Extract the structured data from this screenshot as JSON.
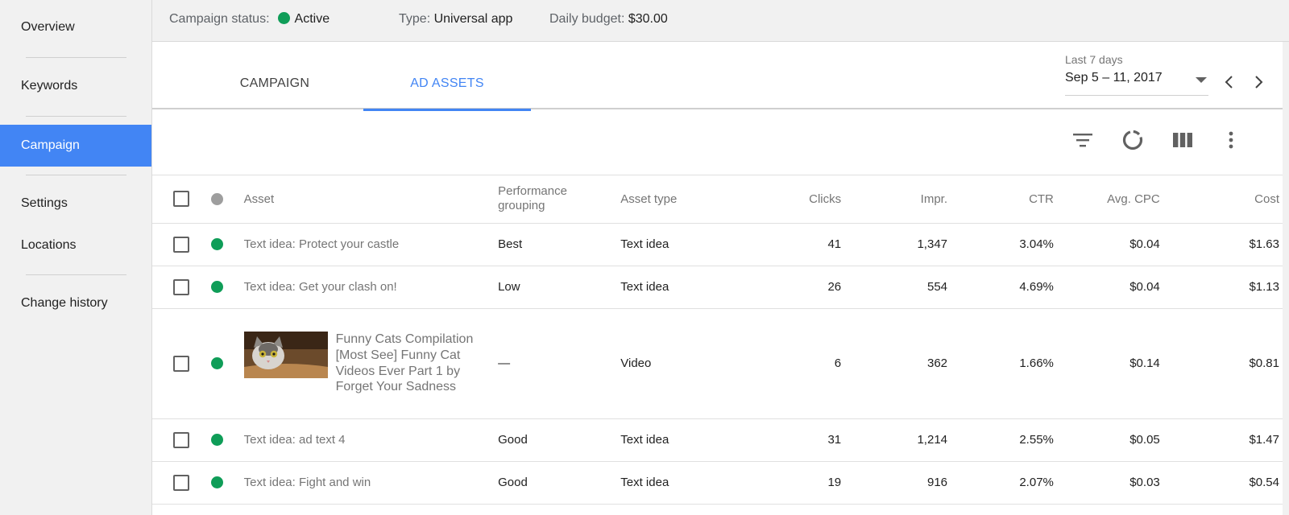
{
  "sidebar": {
    "items": [
      {
        "label": "Overview"
      },
      {
        "label": "Keywords"
      },
      {
        "label": "Campaign"
      },
      {
        "label": "Settings"
      },
      {
        "label": "Locations"
      },
      {
        "label": "Change history"
      }
    ],
    "active": "Campaign"
  },
  "status_bar": {
    "campaign_status_label": "Campaign status:",
    "campaign_status_value": "Active",
    "type_label": "Type:",
    "type_value": "Universal app",
    "budget_label": "Daily budget:",
    "budget_value": "$30.00"
  },
  "tabs": [
    {
      "label": "CAMPAIGN",
      "active": false
    },
    {
      "label": "AD ASSETS",
      "active": true
    }
  ],
  "date_range": {
    "label": "Last 7 days",
    "value": "Sep 5 – 11, 2017"
  },
  "toolbar": {
    "icons": [
      "filter-icon",
      "segment-icon",
      "columns-icon",
      "more-vert-icon"
    ]
  },
  "table": {
    "headers": {
      "asset": "Asset",
      "performance": "Performance grouping",
      "asset_type": "Asset type",
      "clicks": "Clicks",
      "impr": "Impr.",
      "ctr": "CTR",
      "avg_cpc": "Avg. CPC",
      "cost": "Cost"
    },
    "rows": [
      {
        "asset": "Text idea: Protect your castle",
        "performance": "Best",
        "asset_type": "Text idea",
        "clicks": "41",
        "impr": "1,347",
        "ctr": "3.04%",
        "avg_cpc": "$0.04",
        "cost": "$1.63"
      },
      {
        "asset": "Text idea: Get your clash on!",
        "performance": "Low",
        "asset_type": "Text idea",
        "clicks": "26",
        "impr": "554",
        "ctr": "4.69%",
        "avg_cpc": "$0.04",
        "cost": "$1.13"
      },
      {
        "asset": "Funny Cats Compilation [Most See] Funny Cat Videos Ever Part 1 by Forget Your Sadness",
        "performance": "—",
        "asset_type": "Video",
        "clicks": "6",
        "impr": "362",
        "ctr": "1.66%",
        "avg_cpc": "$0.14",
        "cost": "$0.81"
      },
      {
        "asset": "Text idea: ad text 4",
        "performance": "Good",
        "asset_type": "Text idea",
        "clicks": "31",
        "impr": "1,214",
        "ctr": "2.55%",
        "avg_cpc": "$0.05",
        "cost": "$1.47"
      },
      {
        "asset": "Text idea: Fight and win",
        "performance": "Good",
        "asset_type": "Text idea",
        "clicks": "19",
        "impr": "916",
        "ctr": "2.07%",
        "avg_cpc": "$0.03",
        "cost": "$0.54"
      }
    ]
  },
  "colors": {
    "accent": "#4285f4",
    "status_active": "#0f9d58"
  }
}
